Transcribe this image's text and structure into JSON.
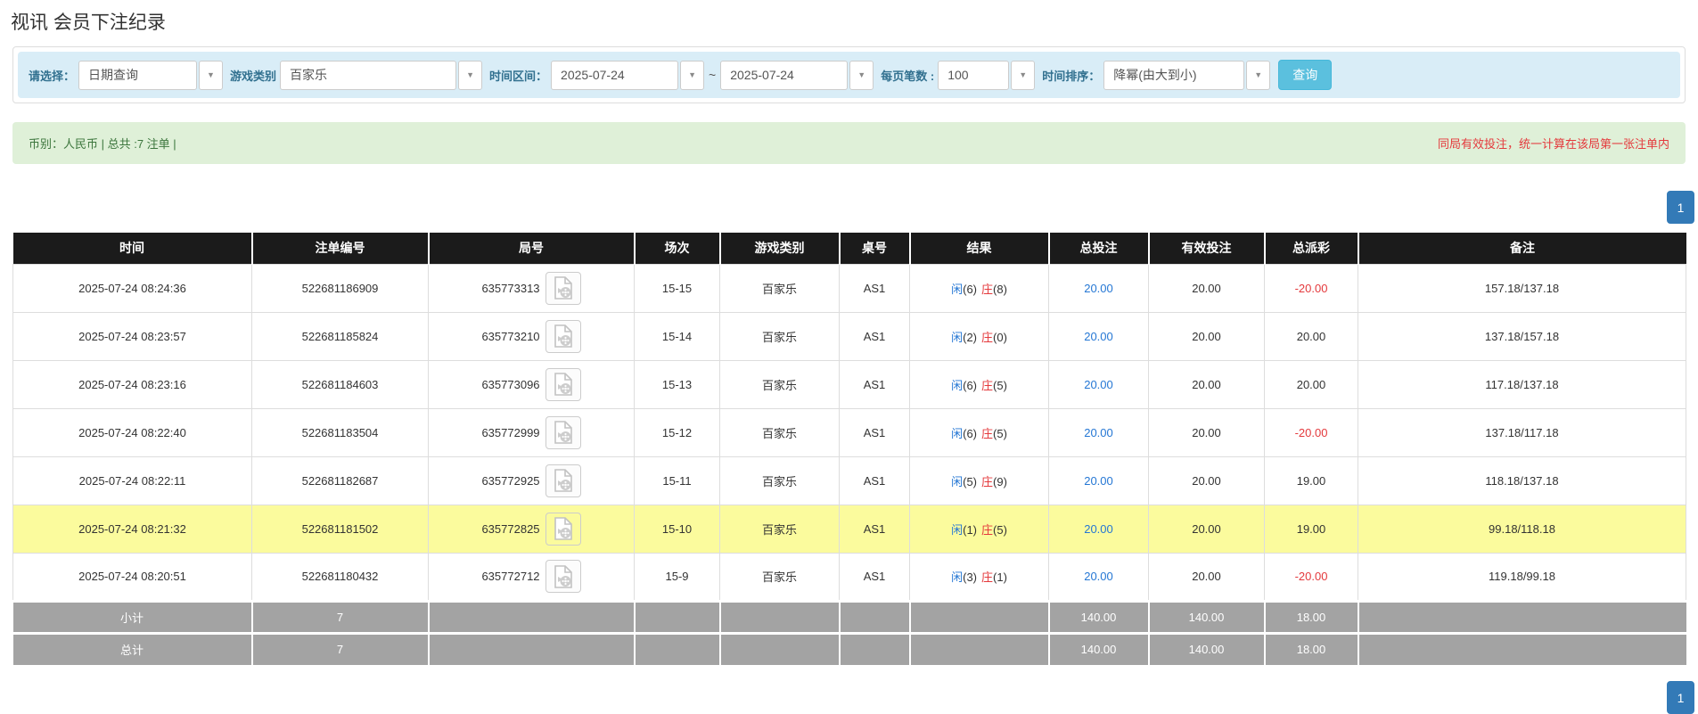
{
  "page_title": "视讯 会员下注纪录",
  "filter_bar": {
    "select_label": "请选择：",
    "select_value": "日期查询",
    "game_type_label": "游戏类别",
    "game_type_value": "百家乐",
    "time_range_label": "时间区间：",
    "date_from": "2025-07-24",
    "range_separator": "~",
    "date_to": "2025-07-24",
    "page_size_label": "每页笔数 :",
    "page_size_value": "100",
    "sort_label": "时间排序：",
    "sort_value": "降幂(由大到小)",
    "query_button_label": "查询"
  },
  "summary_bar": {
    "currency_info": "币别：人民币 | 总共 :7 注单 |",
    "notice": "同局有效投注，统一计算在该局第一张注单内"
  },
  "pagination": {
    "current_page": "1"
  },
  "table": {
    "headers": [
      "时间",
      "注单编号",
      "局号",
      "场次",
      "游戏类别",
      "桌号",
      "结果",
      "总投注",
      "有效投注",
      "总派彩",
      "备注"
    ],
    "rows": [
      {
        "time": "2025-07-24 08:24:36",
        "bet_no": "522681186909",
        "round_no": "635773313",
        "session": "15-15",
        "game_type": "百家乐",
        "table_no": "AS1",
        "result_player": "闲",
        "result_player_score": "(6)",
        "result_banker": "庄",
        "result_banker_score": "(8)",
        "total_bet": "20.00",
        "valid_bet": "20.00",
        "payout": "-20.00",
        "note": "157.18/137.18",
        "highlighted": false
      },
      {
        "time": "2025-07-24 08:23:57",
        "bet_no": "522681185824",
        "round_no": "635773210",
        "session": "15-14",
        "game_type": "百家乐",
        "table_no": "AS1",
        "result_player": "闲",
        "result_player_score": "(2)",
        "result_banker": "庄",
        "result_banker_score": "(0)",
        "total_bet": "20.00",
        "valid_bet": "20.00",
        "payout": "20.00",
        "note": "137.18/157.18",
        "highlighted": false
      },
      {
        "time": "2025-07-24 08:23:16",
        "bet_no": "522681184603",
        "round_no": "635773096",
        "session": "15-13",
        "game_type": "百家乐",
        "table_no": "AS1",
        "result_player": "闲",
        "result_player_score": "(6)",
        "result_banker": "庄",
        "result_banker_score": "(5)",
        "total_bet": "20.00",
        "valid_bet": "20.00",
        "payout": "20.00",
        "note": "117.18/137.18",
        "highlighted": false
      },
      {
        "time": "2025-07-24 08:22:40",
        "bet_no": "522681183504",
        "round_no": "635772999",
        "session": "15-12",
        "game_type": "百家乐",
        "table_no": "AS1",
        "result_player": "闲",
        "result_player_score": "(6)",
        "result_banker": "庄",
        "result_banker_score": "(5)",
        "total_bet": "20.00",
        "valid_bet": "20.00",
        "payout": "-20.00",
        "note": "137.18/117.18",
        "highlighted": false
      },
      {
        "time": "2025-07-24 08:22:11",
        "bet_no": "522681182687",
        "round_no": "635772925",
        "session": "15-11",
        "game_type": "百家乐",
        "table_no": "AS1",
        "result_player": "闲",
        "result_player_score": "(5)",
        "result_banker": "庄",
        "result_banker_score": "(9)",
        "total_bet": "20.00",
        "valid_bet": "20.00",
        "payout": "19.00",
        "note": "118.18/137.18",
        "highlighted": false
      },
      {
        "time": "2025-07-24 08:21:32",
        "bet_no": "522681181502",
        "round_no": "635772825",
        "session": "15-10",
        "game_type": "百家乐",
        "table_no": "AS1",
        "result_player": "闲",
        "result_player_score": "(1)",
        "result_banker": "庄",
        "result_banker_score": "(5)",
        "total_bet": "20.00",
        "valid_bet": "20.00",
        "payout": "19.00",
        "note": "99.18/118.18",
        "highlighted": true
      },
      {
        "time": "2025-07-24 08:20:51",
        "bet_no": "522681180432",
        "round_no": "635772712",
        "session": "15-9",
        "game_type": "百家乐",
        "table_no": "AS1",
        "result_player": "闲",
        "result_player_score": "(3)",
        "result_banker": "庄",
        "result_banker_score": "(1)",
        "total_bet": "20.00",
        "valid_bet": "20.00",
        "payout": "-20.00",
        "note": "119.18/99.18",
        "highlighted": false
      }
    ],
    "subtotal_row": {
      "label": "小计",
      "count": "7",
      "total_bet": "140.00",
      "valid_bet": "140.00",
      "payout": "18.00"
    },
    "total_row": {
      "label": "总计",
      "count": "7",
      "total_bet": "140.00",
      "valid_bet": "140.00",
      "payout": "18.00"
    }
  },
  "icons": {
    "dropdown_arrow": "chevron-down-icon",
    "video_replay": "video-replay-icon"
  },
  "colors": {
    "filter_bar_bg": "#d9edf7",
    "filter_label": "#31708f",
    "query_button": "#5bc0de",
    "summary_bg": "#dff0d8",
    "summary_text": "#3c763d",
    "notice_red": "#e4393c",
    "header_bg": "#1b1b1b",
    "highlight_row": "#fbfb9d",
    "footer_row_bg": "#a3a3a3",
    "pagination_blue": "#337ab7",
    "link_blue": "#2577d4"
  }
}
